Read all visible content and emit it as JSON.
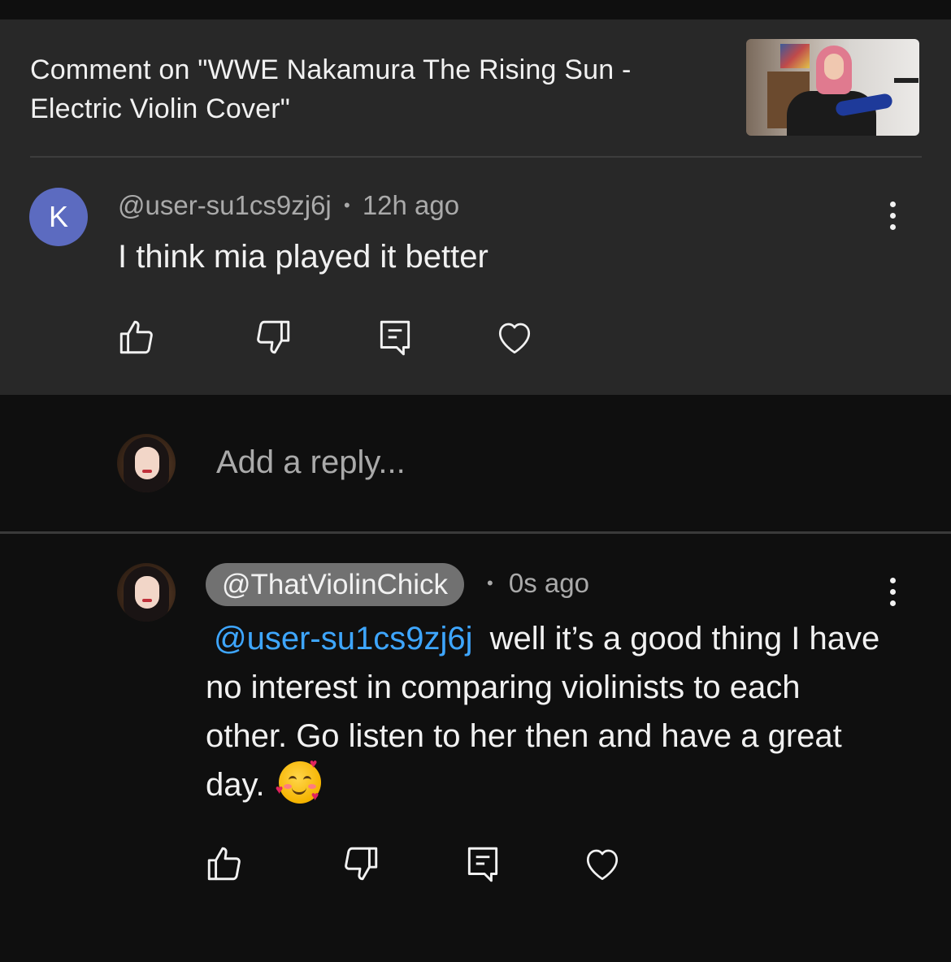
{
  "video": {
    "title": "Comment on \"WWE Nakamura The Rising Sun - Electric Violin Cover\""
  },
  "comment": {
    "avatar_letter": "K",
    "author": "@user-su1cs9zj6j",
    "separator": "•",
    "time": "12h ago",
    "text": "I think mia played it better"
  },
  "reply_box": {
    "placeholder": "Add a reply..."
  },
  "reply": {
    "author": "@ThatViolinChick",
    "separator": "•",
    "time": "0s ago",
    "mention": "@user-su1cs9zj6j",
    "text": "well it’s a good thing I have no interest in comparing violinists to each other. Go listen to her then and have a great day."
  },
  "icons": {
    "like": "thumbs-up-icon",
    "dislike": "thumbs-down-icon",
    "reply": "comment-icon",
    "heart": "heart-icon",
    "more": "more-vertical-icon"
  },
  "colors": {
    "card_bg": "#282828",
    "page_bg": "#0f0f0f",
    "avatar_k": "#5c6bc0",
    "mention": "#3ea6ff",
    "chip_bg": "#717171",
    "secondary_text": "#aaaaaa"
  }
}
